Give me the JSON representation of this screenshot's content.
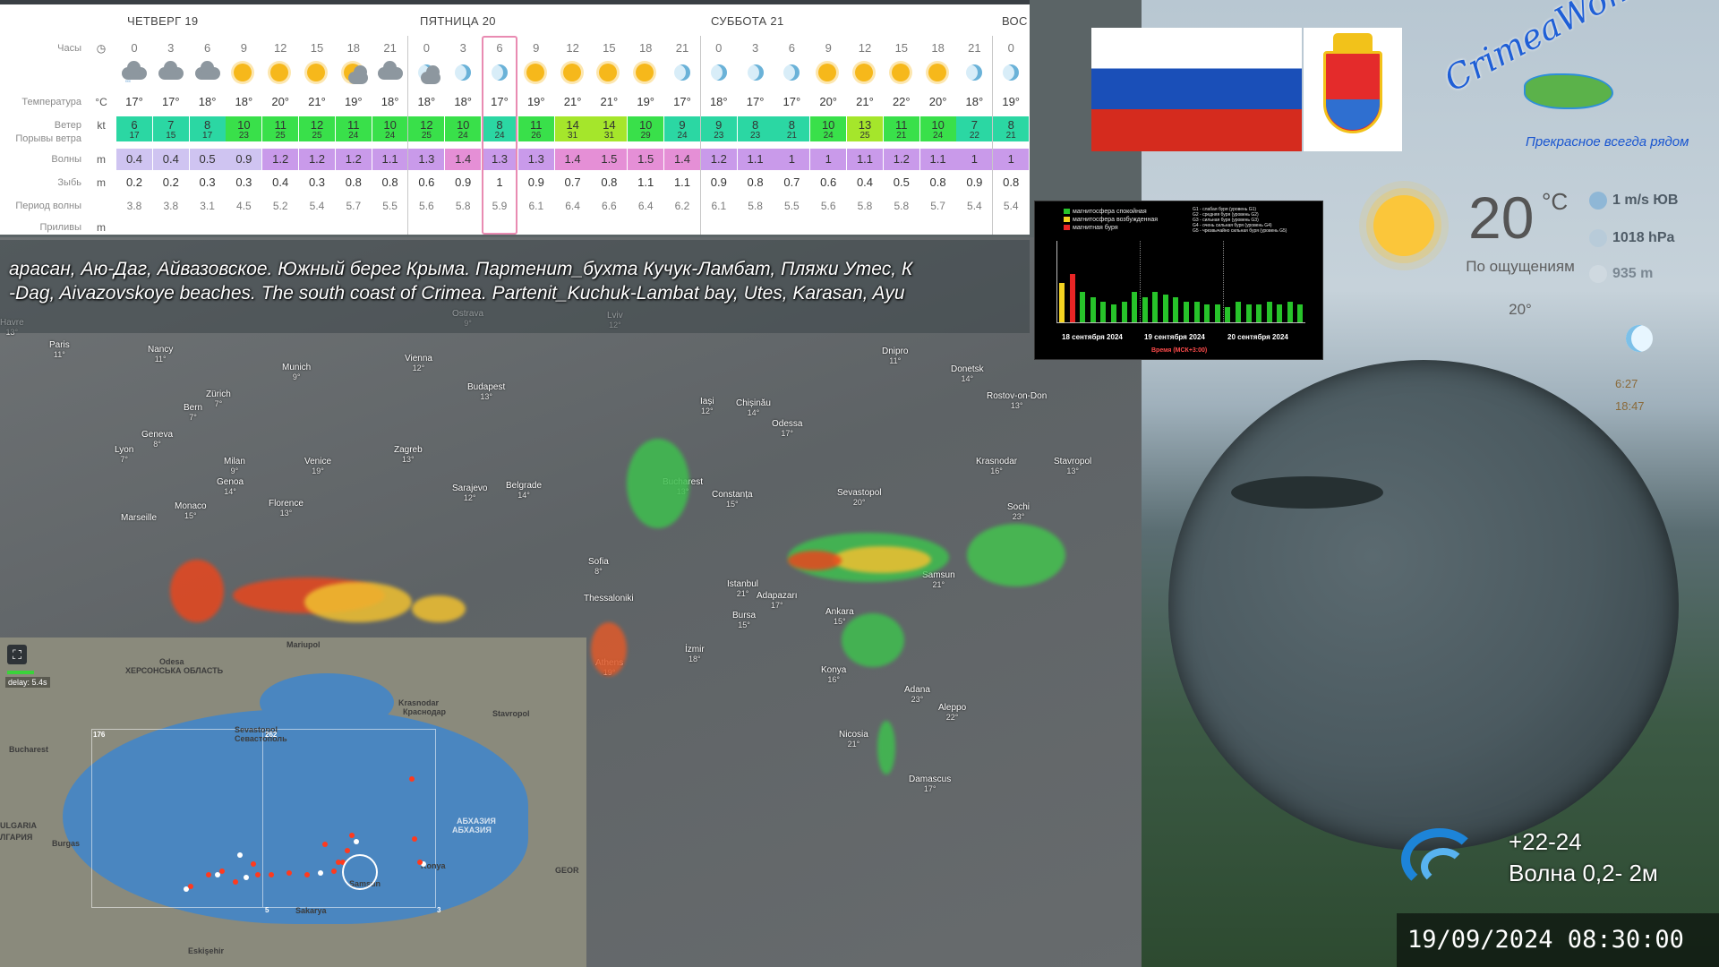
{
  "forecast": {
    "days": [
      "ЧЕТВЕРГ 19",
      "ПЯТНИЦА 20",
      "СУББОТА 21",
      "ВОС"
    ],
    "row_labels": {
      "hours": "Часы",
      "temperature": "Температура",
      "wind": "Ветер",
      "gusts": "Порывы ветра",
      "waves": "Волны",
      "swell": "Зыбь",
      "wave_period": "Период волны",
      "tides": "Приливы"
    },
    "units": {
      "hours": "◷",
      "temperature": "°C",
      "wind": "kt",
      "waves": "m",
      "swell": "m",
      "tides": "m"
    },
    "hours": [
      "0",
      "3",
      "6",
      "9",
      "12",
      "15",
      "18",
      "21",
      "0",
      "3",
      "6",
      "9",
      "12",
      "15",
      "18",
      "21",
      "0",
      "3",
      "6",
      "9",
      "12",
      "15",
      "18",
      "21",
      "0"
    ],
    "icons": [
      "cloud-rain",
      "cloud",
      "cloud",
      "sun",
      "sun",
      "sun",
      "sun-cloud",
      "cloud",
      "moon-cloud",
      "moon",
      "moon",
      "sun",
      "sun",
      "sun",
      "sun",
      "moon",
      "moon",
      "moon",
      "moon",
      "sun",
      "sun",
      "sun",
      "sun",
      "moon",
      "moon"
    ],
    "temperature": [
      "17°",
      "17°",
      "18°",
      "18°",
      "20°",
      "21°",
      "19°",
      "18°",
      "18°",
      "18°",
      "17°",
      "19°",
      "21°",
      "21°",
      "19°",
      "17°",
      "18°",
      "17°",
      "17°",
      "20°",
      "21°",
      "22°",
      "20°",
      "18°",
      "19°"
    ],
    "wind": [
      "6",
      "7",
      "8",
      "10",
      "11",
      "12",
      "11",
      "10",
      "12",
      "10",
      "8",
      "11",
      "14",
      "14",
      "10",
      "9",
      "9",
      "8",
      "8",
      "10",
      "13",
      "11",
      "10",
      "7",
      "8"
    ],
    "gusts": [
      "17",
      "15",
      "17",
      "23",
      "25",
      "25",
      "24",
      "24",
      "25",
      "24",
      "24",
      "26",
      "31",
      "31",
      "29",
      "24",
      "23",
      "23",
      "21",
      "24",
      "25",
      "21",
      "24",
      "22",
      "21"
    ],
    "waves": [
      "0.4",
      "0.4",
      "0.5",
      "0.9",
      "1.2",
      "1.2",
      "1.2",
      "1.1",
      "1.3",
      "1.4",
      "1.3",
      "1.3",
      "1.4",
      "1.5",
      "1.5",
      "1.4",
      "1.2",
      "1.1",
      "1",
      "1",
      "1.1",
      "1.2",
      "1.1",
      "1",
      "1"
    ],
    "swell": [
      "0.2",
      "0.2",
      "0.3",
      "0.3",
      "0.4",
      "0.3",
      "0.8",
      "0.8",
      "0.6",
      "0.9",
      "1",
      "0.9",
      "0.7",
      "0.8",
      "1.1",
      "1.1",
      "0.9",
      "0.8",
      "0.7",
      "0.6",
      "0.4",
      "0.5",
      "0.8",
      "0.9",
      "0.8"
    ],
    "wave_period": [
      "3.8",
      "3.8",
      "3.1",
      "4.5",
      "5.2",
      "5.4",
      "5.7",
      "5.5",
      "5.6",
      "5.8",
      "5.9",
      "6.1",
      "6.4",
      "6.6",
      "6.4",
      "6.2",
      "6.1",
      "5.8",
      "5.5",
      "5.6",
      "5.8",
      "5.8",
      "5.7",
      "5.4",
      "5.4"
    ],
    "colors": {
      "wind_light": "#2bd7a3",
      "wind_mid": "#39e04a",
      "wind_strong": "#a5e62b",
      "waves_low": "#cfc4f1",
      "waves_mid": "#c99aea",
      "waves_high": "#e58fd6",
      "highlight": "#e98bb2"
    }
  },
  "ticker": {
    "line_ru": "арасан, Аю-Даг, Айвазовское.    Южный берег Крыма. Партенит_бухта Кучук-Ламбат, Пляжи Утес,   К",
    "line_en": "-Dag, Aivazovskoye beaches.       The south coast of Crimea. Partenit_Kuchuk-Lambat bay, Utes, Karasan, Ayu"
  },
  "map_cities": [
    {
      "name": "Havre",
      "temp": "13°"
    },
    {
      "name": "Paris",
      "temp": "11°"
    },
    {
      "name": "Nancy",
      "temp": "11°"
    },
    {
      "name": "Munich",
      "temp": "9°"
    },
    {
      "name": "Vienna",
      "temp": "12°"
    },
    {
      "name": "Budapest",
      "temp": "13°"
    },
    {
      "name": "Ostrava",
      "temp": "9°"
    },
    {
      "name": "Lviv",
      "temp": "12°"
    },
    {
      "name": "Zürich",
      "temp": "7°"
    },
    {
      "name": "Bern",
      "temp": "7°"
    },
    {
      "name": "Geneva",
      "temp": "8°"
    },
    {
      "name": "Lyon",
      "temp": "7°"
    },
    {
      "name": "Milan",
      "temp": "9°"
    },
    {
      "name": "Venice",
      "temp": "19°"
    },
    {
      "name": "Zagreb",
      "temp": "13°"
    },
    {
      "name": "Genoa",
      "temp": "14°"
    },
    {
      "name": "Monaco",
      "temp": "15°"
    },
    {
      "name": "Florence",
      "temp": "13°"
    },
    {
      "name": "Sarajevo",
      "temp": "12°"
    },
    {
      "name": "Marseille",
      "temp": ""
    },
    {
      "name": "Belgrade",
      "temp": "14°"
    },
    {
      "name": "Iași",
      "temp": "12°"
    },
    {
      "name": "Chișinău",
      "temp": "14°"
    },
    {
      "name": "Odessa",
      "temp": "17°"
    },
    {
      "name": "Dnipro",
      "temp": "11°"
    },
    {
      "name": "Donetsk",
      "temp": "14°"
    },
    {
      "name": "Rostov-on-Don",
      "temp": "13°"
    },
    {
      "name": "Bucharest",
      "temp": "13°"
    },
    {
      "name": "Constanța",
      "temp": "15°"
    },
    {
      "name": "Sevastopol",
      "temp": "20°"
    },
    {
      "name": "Krasnodar",
      "temp": "16°"
    },
    {
      "name": "Stavropol",
      "temp": "13°"
    },
    {
      "name": "Sochi",
      "temp": "23°"
    },
    {
      "name": "Sofia",
      "temp": "8°"
    },
    {
      "name": "Istanbul",
      "temp": "21°"
    },
    {
      "name": "Adapazarı",
      "temp": "17°"
    },
    {
      "name": "Samsun",
      "temp": "21°"
    },
    {
      "name": "Bursa",
      "temp": "15°"
    },
    {
      "name": "Ankara",
      "temp": "15°"
    },
    {
      "name": "Thessaloniki",
      "temp": ""
    },
    {
      "name": "İzmir",
      "temp": "18°"
    },
    {
      "name": "Athens",
      "temp": "19°"
    },
    {
      "name": "Konya",
      "temp": "16°"
    },
    {
      "name": "Adana",
      "temp": "23°"
    },
    {
      "name": "Aleppo",
      "temp": "22°"
    },
    {
      "name": "Nicosia",
      "temp": "21°"
    },
    {
      "name": "Damascus",
      "temp": "17°"
    }
  ],
  "lightning_inset": {
    "delay": "delay: 5.4s",
    "labels": [
      "Odesa",
      "ХЕРСОНСЬКА ОБЛАСТЬ",
      "Mariupol",
      "Krasnodar",
      "Краснодар",
      "Sevastopol",
      "Севастополь",
      "Stavropol",
      "Bucharest",
      "ULGARIA",
      "ЛГАРИЯ",
      "Burgas",
      "АБХАЗИЯ",
      "АБХАЗИЯ",
      "Samsun",
      "Sakarya",
      "Eskişehir",
      "GEOR",
      "Konya"
    ],
    "grid_labels": [
      "176",
      "262",
      "5",
      "3"
    ]
  },
  "geomag": {
    "legend": [
      "магнитосфера спокойная",
      "магнитосфера возбужденная",
      "магнитная буря"
    ],
    "legend_right": [
      "G1 - слабая буря (уровень G1)",
      "G2 - средняя буря (уровень G2)",
      "G3 - сильная буря (уровень G3)",
      "G4 - очень сильная буря (уровень G4)",
      "G5 - чрезвычайно сильная буря (уровень G5)"
    ],
    "dates": [
      "18 сентября 2024",
      "19 сентября 2024",
      "20 сентября 2024"
    ],
    "axis_title": "Время (МСК+3:00)",
    "kp_values": [
      4.3,
      5.3,
      3.3,
      2.7,
      2.3,
      2.0,
      2.3,
      3.3,
      2.7,
      3.3,
      3.0,
      2.7,
      2.3,
      2.3,
      2.0,
      2.0,
      1.7,
      2.3,
      2.0,
      2.0,
      2.3,
      2.0,
      2.3,
      2.0
    ],
    "colors": {
      "calm": "#27c32a",
      "excited": "#f4d321",
      "storm": "#e82525"
    }
  },
  "logos": {
    "crimea_wonderland": "CrimeaWonderland",
    "slogan": "Прекрасное всегда рядом"
  },
  "current": {
    "temp": "20",
    "unit": "°C",
    "feels_label": "По ощущениям",
    "feels_value": "20°",
    "wind": "1 m/s ЮВ",
    "pressure": "1018 hPa",
    "cloud_base": "935 m",
    "sunrise": "6:27",
    "sunset": "18:47"
  },
  "wave": {
    "water_temp": "+22-24",
    "height": "Волна  0,2- 2м"
  },
  "timestamp": "19/09/2024 08:30:00"
}
